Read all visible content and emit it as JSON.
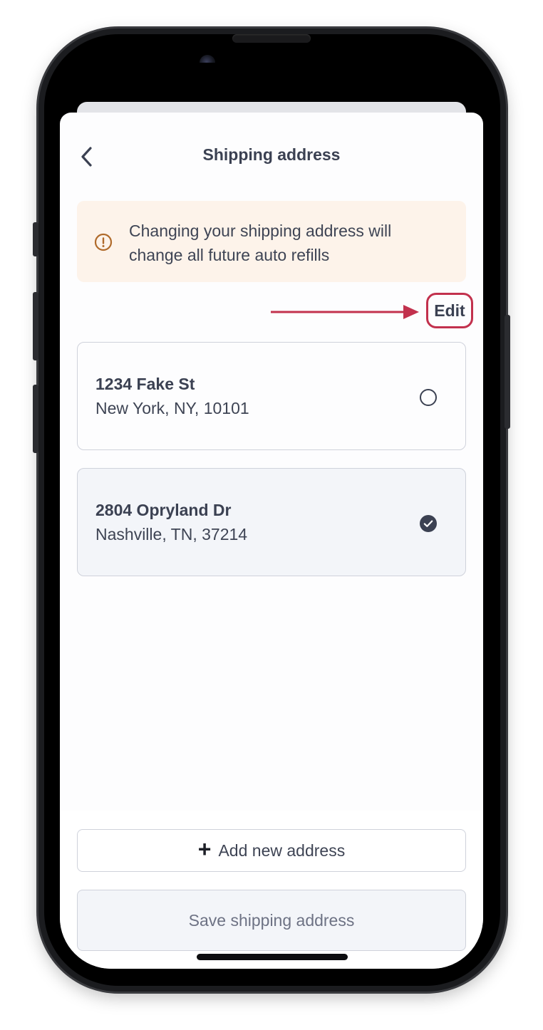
{
  "header": {
    "title": "Shipping address",
    "back_icon": "chevron-left-icon"
  },
  "notice": {
    "icon": "alert-circle-icon",
    "text": "Changing your shipping address will change all future auto refills",
    "background": "#fdf3ea",
    "icon_color": "#b06a2a"
  },
  "edit": {
    "label": "Edit",
    "annotation_color": "#c2314d"
  },
  "addresses": [
    {
      "line1": "1234 Fake St",
      "line2": "New York, NY, 10101",
      "selected": false
    },
    {
      "line1": "2804 Opryland Dr",
      "line2": "Nashville, TN, 37214",
      "selected": true
    }
  ],
  "footer": {
    "add_label": "Add new address",
    "add_icon": "plus-icon",
    "save_label": "Save shipping address"
  }
}
